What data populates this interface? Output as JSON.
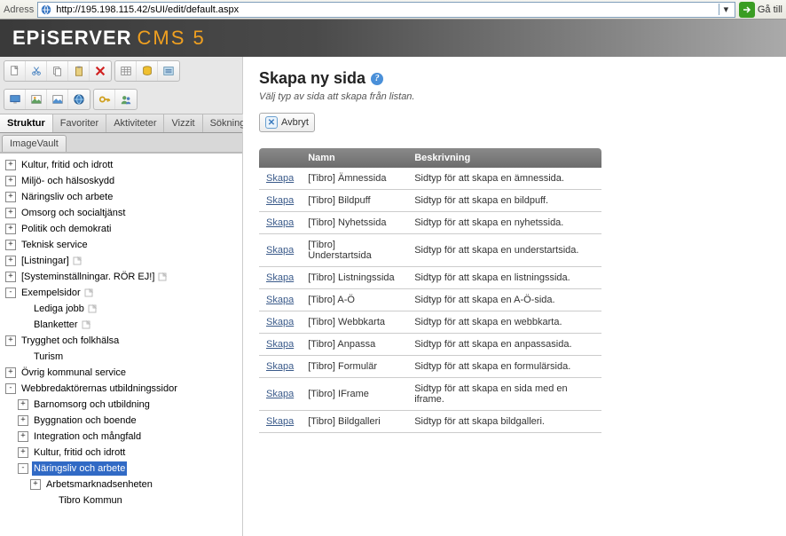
{
  "addressbar": {
    "label": "Adress",
    "url": "http://195.198.115.42/sUI/edit/default.aspx",
    "go_label": "Gå till"
  },
  "brand": {
    "part1": "EPiSERVER",
    "part2": "CMS 5"
  },
  "tabs": {
    "items": [
      "Struktur",
      "Favoriter",
      "Aktiviteter",
      "Vizzit",
      "Sökning"
    ],
    "active_index": 0
  },
  "subtab": {
    "label": "ImageVault"
  },
  "tree": [
    {
      "level": 0,
      "exp": "+",
      "label": "Kultur, fritid och idrott"
    },
    {
      "level": 0,
      "exp": "+",
      "label": "Miljö- och hälsoskydd"
    },
    {
      "level": 0,
      "exp": "+",
      "label": "Näringsliv och arbete"
    },
    {
      "level": 0,
      "exp": "+",
      "label": "Omsorg och socialtjänst"
    },
    {
      "level": 0,
      "exp": "+",
      "label": "Politik och demokrati"
    },
    {
      "level": 0,
      "exp": "+",
      "label": "Teknisk service"
    },
    {
      "level": 0,
      "exp": "+",
      "label": "[Listningar]",
      "icon": true
    },
    {
      "level": 0,
      "exp": "+",
      "label": "[Systeminställningar. RÖR EJ!]",
      "icon": true
    },
    {
      "level": 0,
      "exp": "-",
      "label": "Exempelsidor",
      "icon": true
    },
    {
      "level": 1,
      "exp": "",
      "label": "Lediga jobb",
      "icon": true
    },
    {
      "level": 1,
      "exp": "",
      "label": "Blanketter",
      "icon": true
    },
    {
      "level": 0,
      "exp": "+",
      "label": "Trygghet och folkhälsa"
    },
    {
      "level": 1,
      "exp": "",
      "label": "Turism"
    },
    {
      "level": 0,
      "exp": "+",
      "label": "Övrig kommunal service"
    },
    {
      "level": 0,
      "exp": "-",
      "label": "Webbredaktörernas utbildningssidor"
    },
    {
      "level": 1,
      "exp": "+",
      "label": "Barnomsorg och utbildning"
    },
    {
      "level": 1,
      "exp": "+",
      "label": "Byggnation och boende"
    },
    {
      "level": 1,
      "exp": "+",
      "label": "Integration och mångfald"
    },
    {
      "level": 1,
      "exp": "+",
      "label": "Kultur, fritid och idrott"
    },
    {
      "level": 1,
      "exp": "-",
      "label": "Näringsliv och arbete",
      "selected": true
    },
    {
      "level": 2,
      "exp": "+",
      "label": "Arbetsmarknadsenheten"
    },
    {
      "level": 3,
      "exp": "",
      "label": "Tibro Kommun"
    }
  ],
  "main": {
    "title": "Skapa ny sida",
    "subtitle": "Välj typ av sida att skapa från listan.",
    "cancel_label": "Avbryt",
    "table": {
      "headers": [
        "",
        "Namn",
        "Beskrivning"
      ],
      "create_label": "Skapa",
      "rows": [
        {
          "name": "[Tibro] Ämnessida",
          "desc": "Sidtyp för att skapa en ämnessida."
        },
        {
          "name": "[Tibro] Bildpuff",
          "desc": "Sidtyp för att skapa en bildpuff."
        },
        {
          "name": "[Tibro] Nyhetssida",
          "desc": "Sidtyp för att skapa en nyhetssida."
        },
        {
          "name": "[Tibro] Understartsida",
          "desc": "Sidtyp för att skapa en understartsida."
        },
        {
          "name": "[Tibro] Listningssida",
          "desc": "Sidtyp för att skapa en listningssida."
        },
        {
          "name": "[Tibro] A-Ö",
          "desc": "Sidtyp för att skapa en A-Ö-sida."
        },
        {
          "name": "[Tibro] Webbkarta",
          "desc": "Sidtyp för att skapa en webbkarta."
        },
        {
          "name": "[Tibro] Anpassa",
          "desc": "Sidtyp för att skapa en anpassasida."
        },
        {
          "name": "[Tibro] Formulär",
          "desc": "Sidtyp för att skapa en formulärsida."
        },
        {
          "name": "[Tibro] IFrame",
          "desc": "Sidtyp för att skapa en sida med en iframe."
        },
        {
          "name": "[Tibro] Bildgalleri",
          "desc": "Sidtyp för att skapa bildgalleri."
        }
      ]
    }
  },
  "toolbar_icons_row1": [
    "new-page",
    "cut",
    "copy",
    "paste",
    "delete",
    "sep",
    "table",
    "db",
    "list"
  ],
  "toolbar_icons_row2": [
    "monitor",
    "image1",
    "image2",
    "globe",
    "sep",
    "key",
    "users"
  ]
}
